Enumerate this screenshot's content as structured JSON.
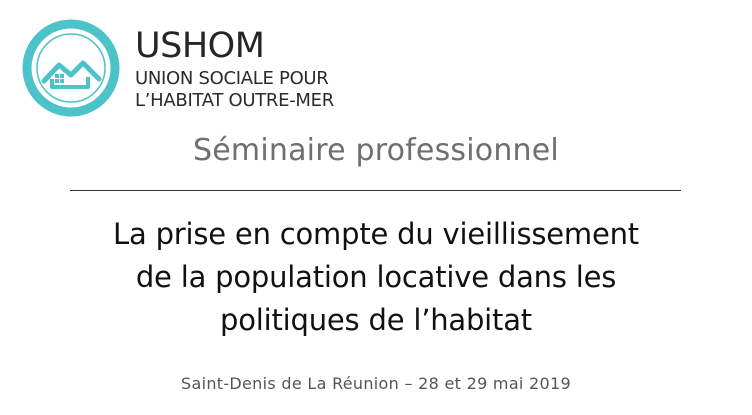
{
  "header": {
    "logo_icon": "ushom-house-ring-logo",
    "brand_name": "USHOM",
    "brand_line1": "UNION SOCIALE POUR",
    "brand_line2": "L’HABITAT OUTRE-MER"
  },
  "seminar_label": "Séminaire professionnel",
  "title_lines": [
    "La prise en compte du vieillissement",
    "de la population locative dans les",
    "politiques de l’habitat"
  ],
  "event_info": "Saint-Denis de La Réunion – 28 et 29 mai 2019",
  "colors": {
    "logo_teal": "#4cc2c9",
    "seminar_grey": "#6f6f6f",
    "title_black": "#111111"
  }
}
